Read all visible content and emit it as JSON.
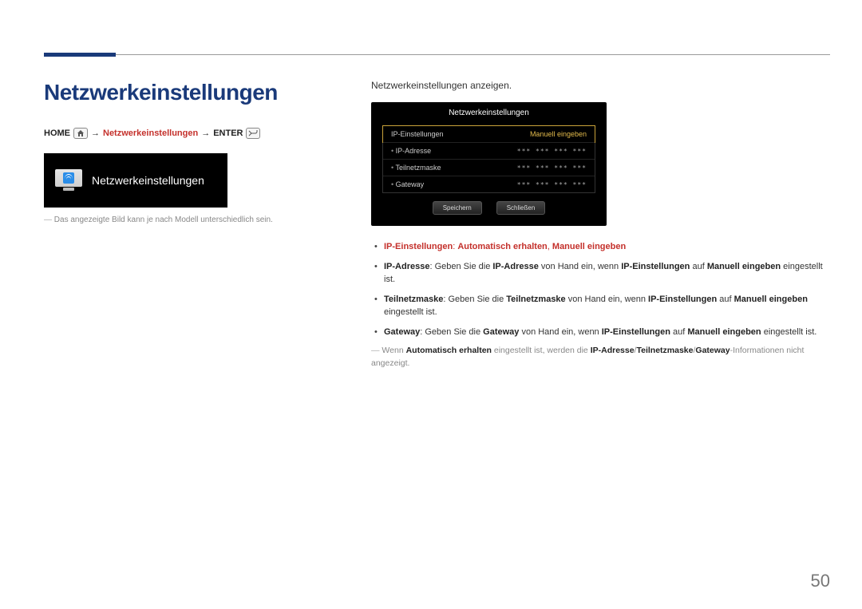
{
  "page_number": "50",
  "heading": "Netzwerkeinstellungen",
  "breadcrumb": {
    "home": "HOME",
    "arrow": "→",
    "mid": "Netzwerkeinstellungen",
    "enter": "ENTER"
  },
  "menu_tile": {
    "label": "Netzwerkeinstellungen"
  },
  "left_footnote": "Das angezeigte Bild kann je nach Modell unterschiedlich sein.",
  "intro": "Netzwerkeinstellungen anzeigen.",
  "panel": {
    "title": "Netzwerkeinstellungen",
    "rows": [
      {
        "label": "IP-Einstellungen",
        "value": "Manuell eingeben",
        "highlight": true
      },
      {
        "label": "IP-Adresse",
        "value": "***   ***   ***   ***"
      },
      {
        "label": "Teilnetzmaske",
        "value": "***   ***   ***   ***"
      },
      {
        "label": "Gateway",
        "value": "***   ***   ***   ***"
      }
    ],
    "buttons": {
      "save": "Speichern",
      "close": "Schließen"
    }
  },
  "bullets": {
    "b1": {
      "ip_settings": "IP-Einstellungen",
      "colon": ": ",
      "auto": "Automatisch erhalten",
      "comma": ", ",
      "manual": "Manuell eingeben"
    },
    "b2": {
      "lead": "IP-Adresse",
      "t1": ": Geben Sie die ",
      "term": "IP-Adresse",
      "t2": " von Hand ein, wenn ",
      "ip": "IP-Einstellungen",
      "t3": " auf ",
      "manual": "Manuell eingeben",
      "t4": " eingestellt ist."
    },
    "b3": {
      "lead": "Teilnetzmaske",
      "t1": ": Geben Sie die ",
      "term": "Teilnetzmaske",
      "t2": " von Hand ein, wenn ",
      "ip": "IP-Einstellungen",
      "t3": " auf ",
      "manual": "Manuell eingeben",
      "t4": " eingestellt ist."
    },
    "b4": {
      "lead": "Gateway",
      "t1": ": Geben Sie die ",
      "term": "Gateway",
      "t2": " von Hand ein, wenn ",
      "ip": "IP-Einstellungen",
      "t3": " auf ",
      "manual": "Manuell eingeben",
      "t4": " eingestellt ist."
    }
  },
  "note": {
    "t1": "Wenn ",
    "auto": "Automatisch erhalten",
    "t2": " eingestellt ist, werden die ",
    "ip": "IP-Adresse",
    "s1": "/",
    "sub": "Teilnetzmaske",
    "s2": "/",
    "gw": "Gateway",
    "t3": "-Informationen nicht angezeigt."
  }
}
